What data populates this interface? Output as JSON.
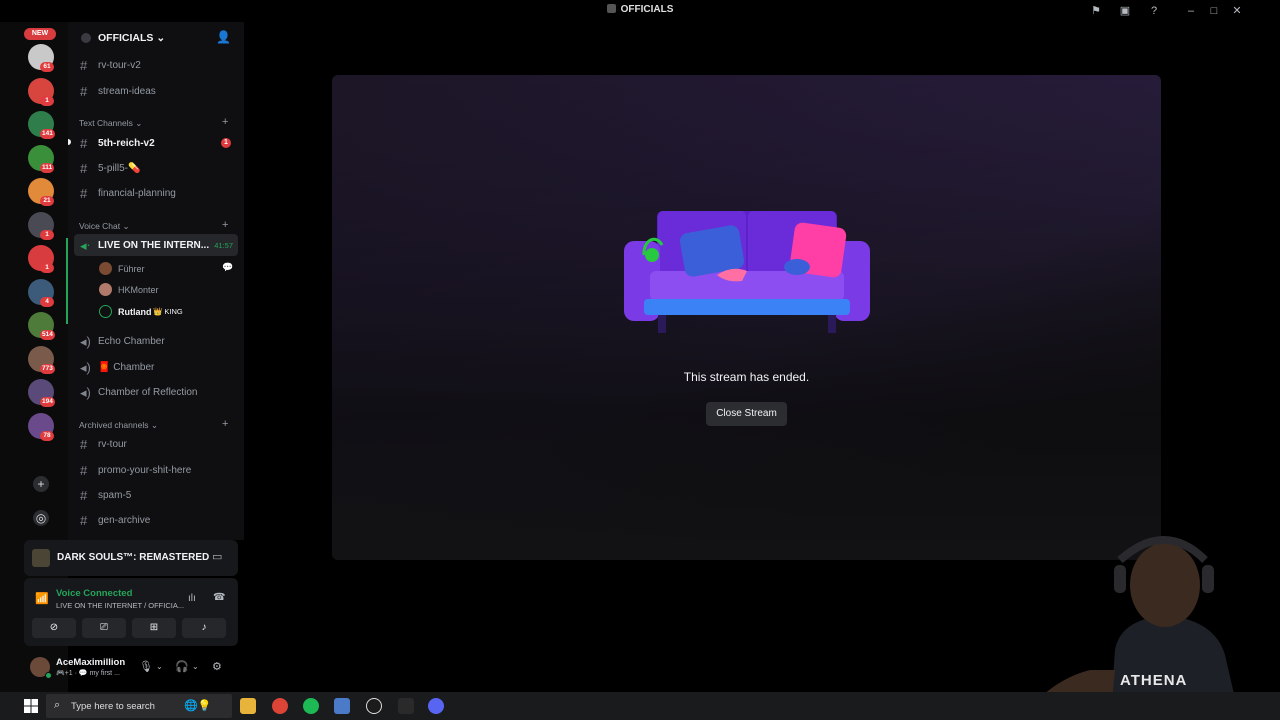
{
  "window": {
    "title": "OFFICIALS"
  },
  "rail": {
    "new_label": "NEW",
    "servers": [
      {
        "badge": "61",
        "color": "#c9c9c9"
      },
      {
        "badge": "1",
        "color": "#d8453f"
      },
      {
        "badge": "141",
        "color": "#2f7d4b"
      },
      {
        "badge": "111",
        "color": "#3a8f3a"
      },
      {
        "badge": "21",
        "color": "#e08a3a"
      },
      {
        "badge": "1",
        "color": "#4a4a55"
      },
      {
        "badge": "1",
        "color": "#d83c3e"
      },
      {
        "badge": "4",
        "color": "#3c5a7a"
      },
      {
        "badge": "514",
        "color": "#4e7a3a"
      },
      {
        "badge": "773",
        "color": "#7a5a4a"
      },
      {
        "badge": "194",
        "color": "#5a4a7a"
      },
      {
        "badge": "78",
        "color": "#6a4a8a"
      }
    ]
  },
  "server": {
    "name": "OFFICIALS"
  },
  "channels_top": [
    {
      "name": "rv-tour-v2"
    },
    {
      "name": "stream-ideas"
    }
  ],
  "categories": {
    "text": "Text Channels",
    "voice": "Voice Chat",
    "archived": "Archived channels"
  },
  "text_channels": [
    {
      "name": "5th-reich-v2",
      "unread": "1"
    },
    {
      "name": "5-pill5-💊"
    },
    {
      "name": "financial-planning"
    }
  ],
  "voice_channels": {
    "live": {
      "name": "LIVE ON THE INTERN...",
      "timer": "41:57"
    },
    "users": [
      {
        "name": "Führer"
      },
      {
        "name": "HKMonter"
      },
      {
        "name": "Rutland",
        "role": "👑 KING"
      }
    ],
    "others": [
      {
        "name": "Echo Chamber"
      },
      {
        "name": "🧧 Chamber"
      },
      {
        "name": "Chamber of Reflection"
      }
    ]
  },
  "archived_channels": [
    {
      "name": "rv-tour"
    },
    {
      "name": "promo-your-shit-here"
    },
    {
      "name": "spam-5"
    },
    {
      "name": "gen-archive"
    }
  ],
  "activity": {
    "game": "DARK SOULS™: REMASTERED"
  },
  "voice_panel": {
    "status": "Voice Connected",
    "channel": "LIVE ON THE INTERNET / OFFICIA..."
  },
  "user": {
    "name": "AceMaximillion",
    "status": "🎮+1 · 💬 my first ..."
  },
  "stream": {
    "ended_text": "This stream has ended.",
    "close_label": "Close Stream"
  },
  "taskbar": {
    "search_placeholder": "Type here to search"
  },
  "colors": {
    "accent_green": "#23a55a",
    "badge_red": "#e03b3e",
    "couch_purple": "#6a2cd8"
  }
}
